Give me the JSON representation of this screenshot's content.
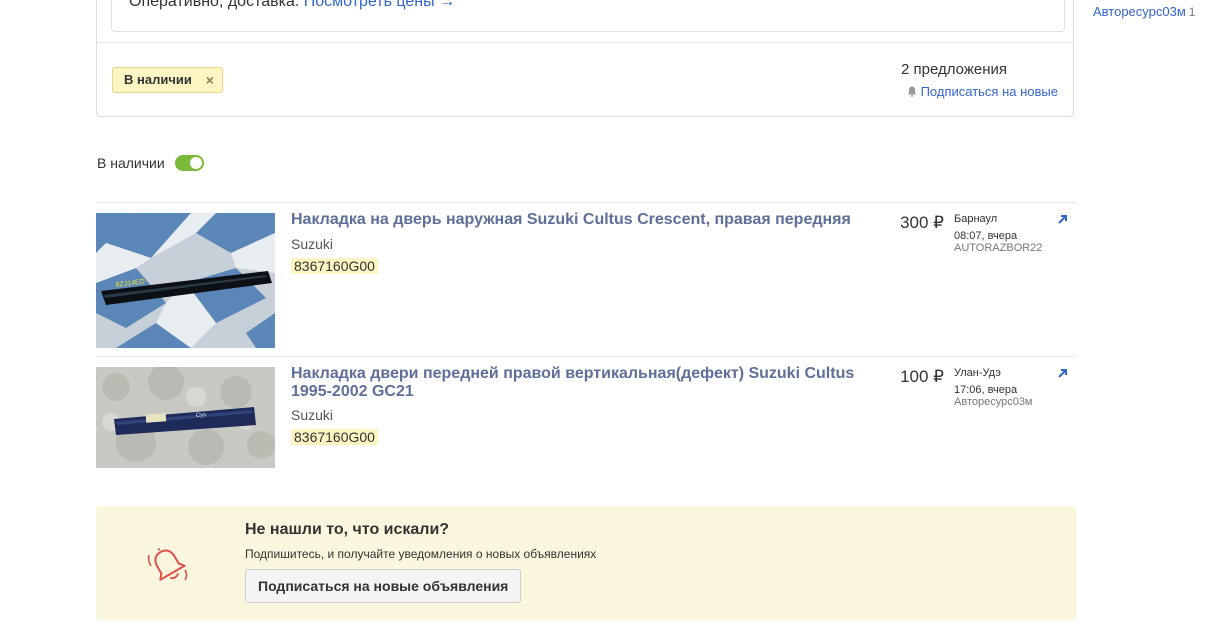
{
  "filter_card": {
    "promo_text": "Оперативно, доставка. ",
    "promo_link": "Посмотреть цены →",
    "chip_label": "В наличии",
    "chip_close": "×",
    "offers_count": "2 предложения",
    "subscribe_link": "Подписаться на новые"
  },
  "right_panel": {
    "seller": "Авторесурс03м",
    "count": "1"
  },
  "availability_toggle": {
    "label": "В наличии",
    "on": true
  },
  "listings": [
    {
      "title": "Накладка на дверь наружная Suzuki Cultus Crescent, правая передняя",
      "brand": "Suzuki",
      "part_number": "8367160G00",
      "price": "300 ₽",
      "city": "Барнаул",
      "time": "08:07, вчера",
      "seller": "AUTORAZBOR22",
      "thumb_label": "8ZJ14ЕD"
    },
    {
      "title": "Накладка двери передней правой вертикальная(дефект) Suzuki Cultus 1995-2002 GC21",
      "brand": "Suzuki",
      "part_number": "8367160G00",
      "price": "100 ₽",
      "city": "Улан-Удэ",
      "time": "17:06, вчера",
      "seller": "Авторесурс03м",
      "thumb_label": "Суз"
    }
  ],
  "subscribe_box": {
    "title": "Не нашли то, что искали?",
    "description": "Подпишитесь, и получайте уведомления о новых объявлениях",
    "button": "Подписаться на новые объявления"
  },
  "colors": {
    "link": "#3366cc",
    "title": "#5f6f99",
    "highlight": "#fdf6c3",
    "toggle_on": "#7bb93a",
    "bell_accent": "#e0504a"
  }
}
